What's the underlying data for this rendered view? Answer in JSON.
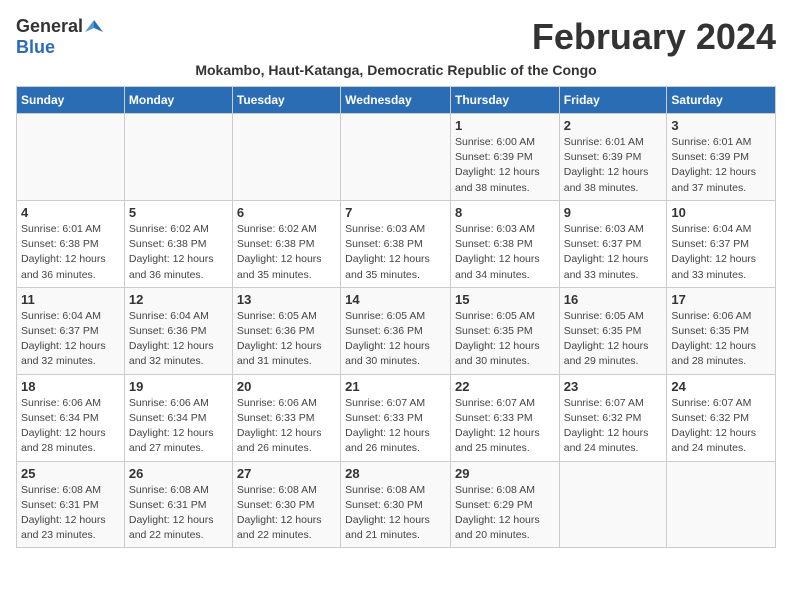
{
  "header": {
    "logo_general": "General",
    "logo_blue": "Blue",
    "month_title": "February 2024",
    "subtitle": "Mokambo, Haut-Katanga, Democratic Republic of the Congo"
  },
  "weekdays": [
    "Sunday",
    "Monday",
    "Tuesday",
    "Wednesday",
    "Thursday",
    "Friday",
    "Saturday"
  ],
  "weeks": [
    [
      {
        "day": "",
        "info": ""
      },
      {
        "day": "",
        "info": ""
      },
      {
        "day": "",
        "info": ""
      },
      {
        "day": "",
        "info": ""
      },
      {
        "day": "1",
        "info": "Sunrise: 6:00 AM\nSunset: 6:39 PM\nDaylight: 12 hours\nand 38 minutes."
      },
      {
        "day": "2",
        "info": "Sunrise: 6:01 AM\nSunset: 6:39 PM\nDaylight: 12 hours\nand 38 minutes."
      },
      {
        "day": "3",
        "info": "Sunrise: 6:01 AM\nSunset: 6:39 PM\nDaylight: 12 hours\nand 37 minutes."
      }
    ],
    [
      {
        "day": "4",
        "info": "Sunrise: 6:01 AM\nSunset: 6:38 PM\nDaylight: 12 hours\nand 36 minutes."
      },
      {
        "day": "5",
        "info": "Sunrise: 6:02 AM\nSunset: 6:38 PM\nDaylight: 12 hours\nand 36 minutes."
      },
      {
        "day": "6",
        "info": "Sunrise: 6:02 AM\nSunset: 6:38 PM\nDaylight: 12 hours\nand 35 minutes."
      },
      {
        "day": "7",
        "info": "Sunrise: 6:03 AM\nSunset: 6:38 PM\nDaylight: 12 hours\nand 35 minutes."
      },
      {
        "day": "8",
        "info": "Sunrise: 6:03 AM\nSunset: 6:38 PM\nDaylight: 12 hours\nand 34 minutes."
      },
      {
        "day": "9",
        "info": "Sunrise: 6:03 AM\nSunset: 6:37 PM\nDaylight: 12 hours\nand 33 minutes."
      },
      {
        "day": "10",
        "info": "Sunrise: 6:04 AM\nSunset: 6:37 PM\nDaylight: 12 hours\nand 33 minutes."
      }
    ],
    [
      {
        "day": "11",
        "info": "Sunrise: 6:04 AM\nSunset: 6:37 PM\nDaylight: 12 hours\nand 32 minutes."
      },
      {
        "day": "12",
        "info": "Sunrise: 6:04 AM\nSunset: 6:36 PM\nDaylight: 12 hours\nand 32 minutes."
      },
      {
        "day": "13",
        "info": "Sunrise: 6:05 AM\nSunset: 6:36 PM\nDaylight: 12 hours\nand 31 minutes."
      },
      {
        "day": "14",
        "info": "Sunrise: 6:05 AM\nSunset: 6:36 PM\nDaylight: 12 hours\nand 30 minutes."
      },
      {
        "day": "15",
        "info": "Sunrise: 6:05 AM\nSunset: 6:35 PM\nDaylight: 12 hours\nand 30 minutes."
      },
      {
        "day": "16",
        "info": "Sunrise: 6:05 AM\nSunset: 6:35 PM\nDaylight: 12 hours\nand 29 minutes."
      },
      {
        "day": "17",
        "info": "Sunrise: 6:06 AM\nSunset: 6:35 PM\nDaylight: 12 hours\nand 28 minutes."
      }
    ],
    [
      {
        "day": "18",
        "info": "Sunrise: 6:06 AM\nSunset: 6:34 PM\nDaylight: 12 hours\nand 28 minutes."
      },
      {
        "day": "19",
        "info": "Sunrise: 6:06 AM\nSunset: 6:34 PM\nDaylight: 12 hours\nand 27 minutes."
      },
      {
        "day": "20",
        "info": "Sunrise: 6:06 AM\nSunset: 6:33 PM\nDaylight: 12 hours\nand 26 minutes."
      },
      {
        "day": "21",
        "info": "Sunrise: 6:07 AM\nSunset: 6:33 PM\nDaylight: 12 hours\nand 26 minutes."
      },
      {
        "day": "22",
        "info": "Sunrise: 6:07 AM\nSunset: 6:33 PM\nDaylight: 12 hours\nand 25 minutes."
      },
      {
        "day": "23",
        "info": "Sunrise: 6:07 AM\nSunset: 6:32 PM\nDaylight: 12 hours\nand 24 minutes."
      },
      {
        "day": "24",
        "info": "Sunrise: 6:07 AM\nSunset: 6:32 PM\nDaylight: 12 hours\nand 24 minutes."
      }
    ],
    [
      {
        "day": "25",
        "info": "Sunrise: 6:08 AM\nSunset: 6:31 PM\nDaylight: 12 hours\nand 23 minutes."
      },
      {
        "day": "26",
        "info": "Sunrise: 6:08 AM\nSunset: 6:31 PM\nDaylight: 12 hours\nand 22 minutes."
      },
      {
        "day": "27",
        "info": "Sunrise: 6:08 AM\nSunset: 6:30 PM\nDaylight: 12 hours\nand 22 minutes."
      },
      {
        "day": "28",
        "info": "Sunrise: 6:08 AM\nSunset: 6:30 PM\nDaylight: 12 hours\nand 21 minutes."
      },
      {
        "day": "29",
        "info": "Sunrise: 6:08 AM\nSunset: 6:29 PM\nDaylight: 12 hours\nand 20 minutes."
      },
      {
        "day": "",
        "info": ""
      },
      {
        "day": "",
        "info": ""
      }
    ]
  ]
}
